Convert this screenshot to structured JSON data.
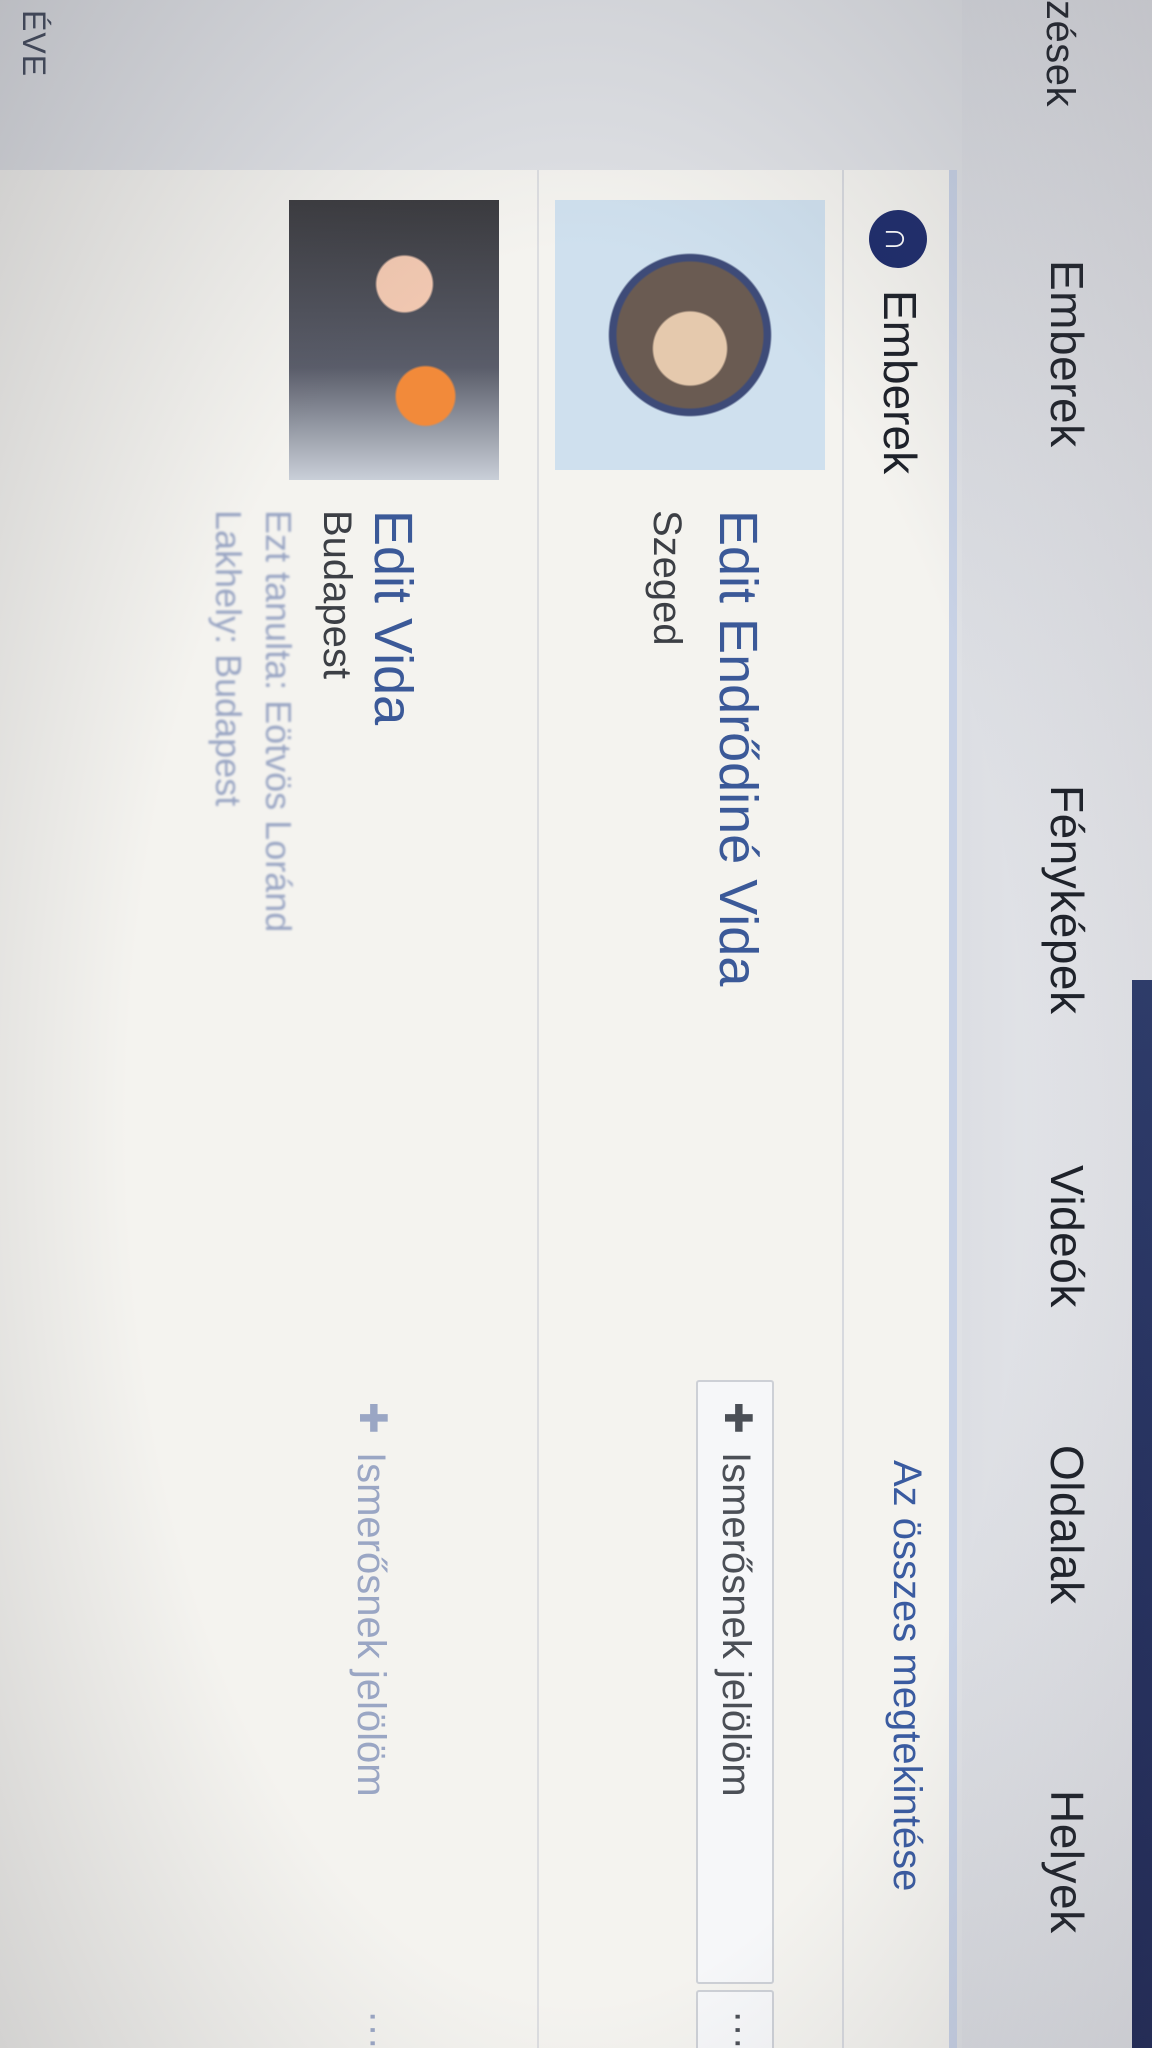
{
  "tabs": {
    "prev_partial": "zések",
    "emberek": "Emberek",
    "fenykepek": "Fényképek",
    "videok": "Videók",
    "oldalak": "Oldalak",
    "helyek": "Helyek"
  },
  "sidebar": {
    "partial_label": "ÉVE"
  },
  "section": {
    "title": "Emberek",
    "see_all": "Az összes megtekintése"
  },
  "results": [
    {
      "name": "Edit Endrődiné Vida",
      "city": "Szeged",
      "add_friend": "Ismerősnek jelölöm",
      "more": "···"
    },
    {
      "name": "Edit Vida",
      "city": "Budapest",
      "extra_1": "Ezt tanulta: Eötvös Loránd",
      "extra_2": "Lakhely: Budapest",
      "add_friend": "Ismerősnek jelölöm",
      "more": "···"
    }
  ],
  "icons": {
    "people": "people-icon",
    "add_friend": "add-friend-icon",
    "caret": "chevron-down-icon"
  },
  "colors": {
    "link": "#3b5998",
    "nav_dark": "#1a2455"
  }
}
